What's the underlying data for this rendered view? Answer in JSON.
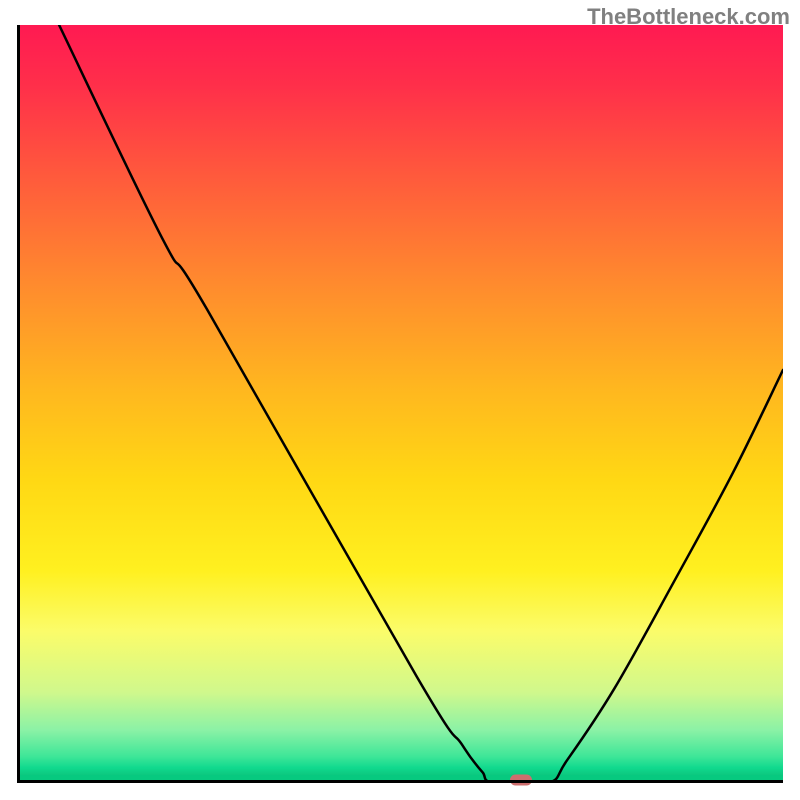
{
  "watermark": "TheBottleneck.com",
  "chart_data": {
    "type": "line",
    "title": "",
    "xlabel": "",
    "ylabel": "",
    "x_range_fraction": [
      0.0,
      1.0
    ],
    "y_range_fraction": [
      0.0,
      1.0
    ],
    "curve_points_xy_fraction": [
      [
        0.055,
        1.0
      ],
      [
        0.19,
        0.718
      ],
      [
        0.248,
        0.625
      ],
      [
        0.522,
        0.14
      ],
      [
        0.58,
        0.052
      ],
      [
        0.595,
        0.03
      ],
      [
        0.608,
        0.014
      ],
      [
        0.622,
        0.0
      ],
      [
        0.693,
        0.0
      ],
      [
        0.718,
        0.03
      ],
      [
        0.78,
        0.125
      ],
      [
        0.86,
        0.27
      ],
      [
        0.935,
        0.41
      ],
      [
        1.0,
        0.545
      ]
    ],
    "marker_xy_fraction": [
      0.658,
      0.0
    ],
    "gradient_stops": [
      {
        "pct": 0,
        "color": "#ff1a52"
      },
      {
        "pct": 8,
        "color": "#ff2f4a"
      },
      {
        "pct": 20,
        "color": "#ff5a3c"
      },
      {
        "pct": 34,
        "color": "#ff8a2e"
      },
      {
        "pct": 48,
        "color": "#ffb71f"
      },
      {
        "pct": 60,
        "color": "#ffd814"
      },
      {
        "pct": 72,
        "color": "#fff020"
      },
      {
        "pct": 80,
        "color": "#fbfc6a"
      },
      {
        "pct": 88,
        "color": "#d0f88c"
      },
      {
        "pct": 93,
        "color": "#8bf2a6"
      },
      {
        "pct": 96.5,
        "color": "#3ee698"
      },
      {
        "pct": 98,
        "color": "#10d98e"
      },
      {
        "pct": 99,
        "color": "#0cc77e"
      },
      {
        "pct": 100,
        "color": "#0abf76"
      }
    ],
    "marker_color": "#cd6e6e"
  }
}
